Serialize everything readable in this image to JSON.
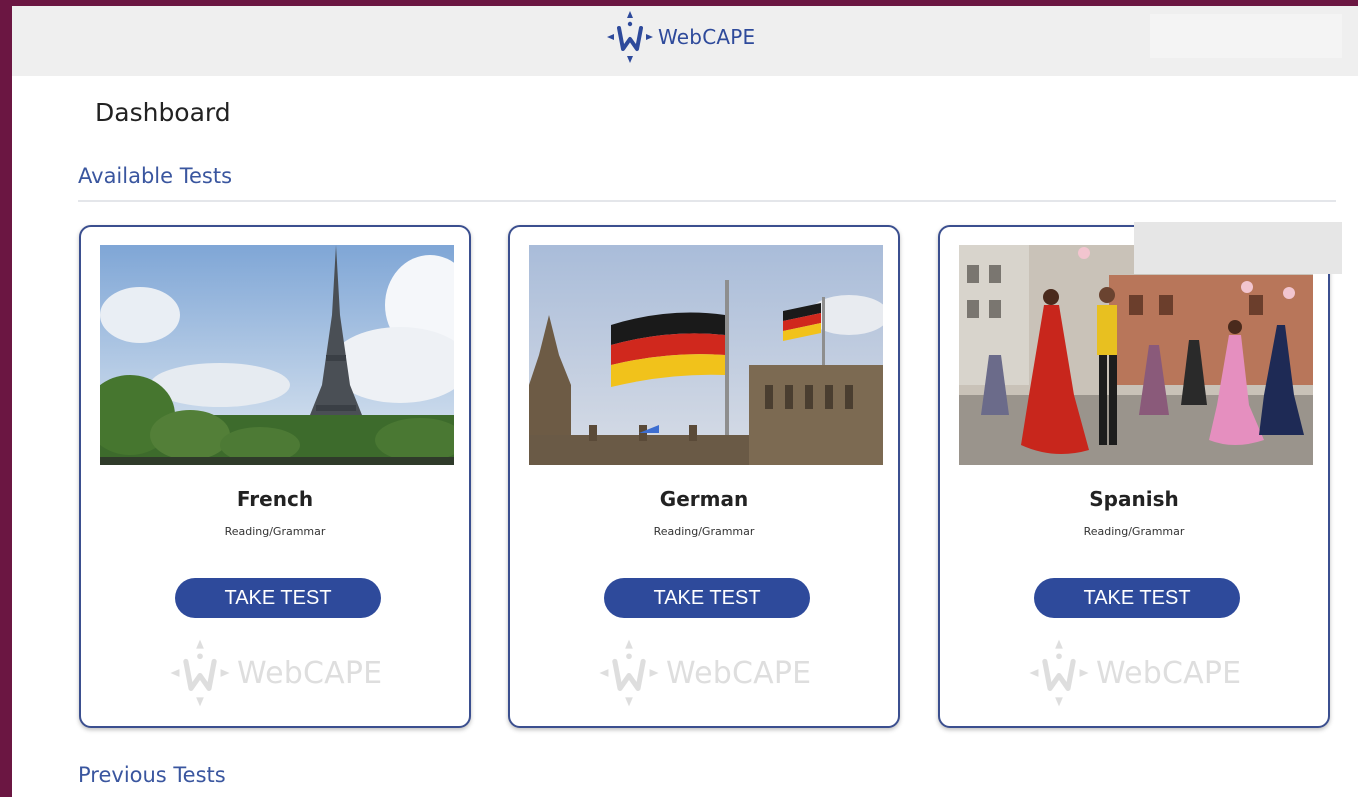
{
  "header": {
    "brand": "WebCAPE",
    "logo_icon": "webcape-compass-logo"
  },
  "page": {
    "title": "Dashboard"
  },
  "sections": {
    "available": "Available Tests",
    "previous": "Previous Tests"
  },
  "tests": [
    {
      "language": "French",
      "type": "Reading/Grammar",
      "button": "TAKE TEST",
      "image": "eiffel-tower-photo",
      "watermark": "WebCAPE"
    },
    {
      "language": "German",
      "type": "Reading/Grammar",
      "button": "TAKE TEST",
      "image": "german-flags-reichstag-photo",
      "watermark": "WebCAPE"
    },
    {
      "language": "Spanish",
      "type": "Reading/Grammar",
      "button": "TAKE TEST",
      "image": "flamenco-dancers-photo",
      "watermark": "WebCAPE"
    }
  ],
  "colors": {
    "brand_blue": "#2e4a9b",
    "card_border": "#3b4f8f",
    "outer_background": "#6b1642",
    "header_background": "#efefef",
    "section_title": "#3a569f"
  }
}
